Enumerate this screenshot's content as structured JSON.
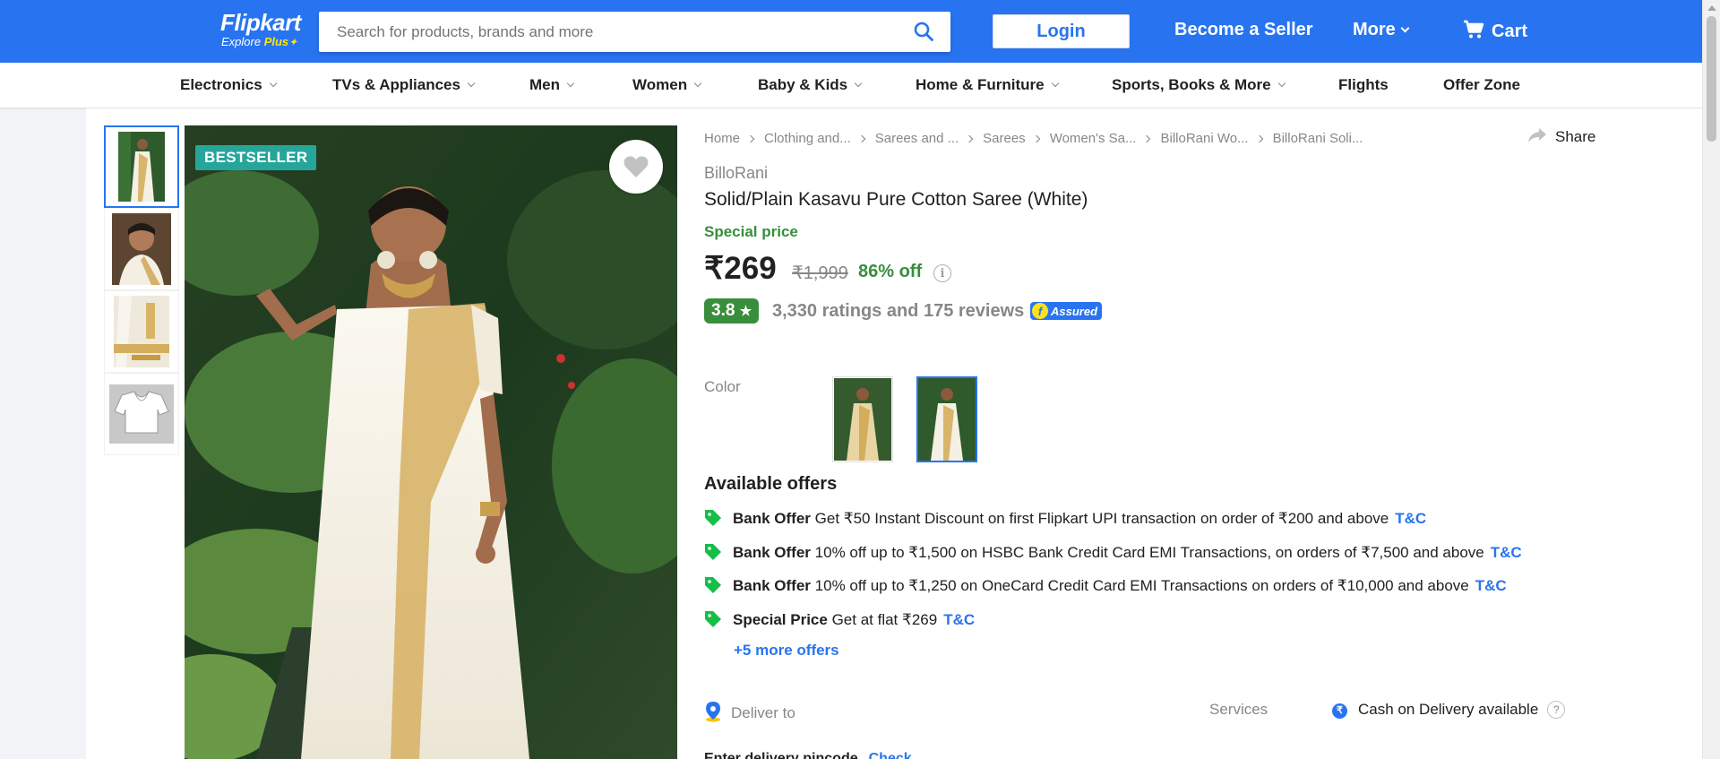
{
  "header": {
    "logo": {
      "brand": "Flipkart",
      "sub_prefix": "Explore",
      "sub_plus": "Plus"
    },
    "search": {
      "placeholder": "Search for products, brands and more",
      "value": ""
    },
    "login_label": "Login",
    "become_seller_label": "Become a Seller",
    "more_label": "More",
    "cart_label": "Cart",
    "colors": {
      "primary": "#2874f0",
      "accent": "#ffe500"
    }
  },
  "category_nav": [
    {
      "label": "Electronics",
      "has_dropdown": true
    },
    {
      "label": "TVs & Appliances",
      "has_dropdown": true
    },
    {
      "label": "Men",
      "has_dropdown": true
    },
    {
      "label": "Women",
      "has_dropdown": true
    },
    {
      "label": "Baby & Kids",
      "has_dropdown": true
    },
    {
      "label": "Home & Furniture",
      "has_dropdown": true
    },
    {
      "label": "Sports, Books & More",
      "has_dropdown": true
    },
    {
      "label": "Flights",
      "has_dropdown": false
    },
    {
      "label": "Offer Zone",
      "has_dropdown": false
    }
  ],
  "gallery": {
    "badge": "BESTSELLER",
    "thumbnails": [
      "saree-full",
      "saree-portrait",
      "saree-fabric",
      "blouse"
    ],
    "active_thumbnail": 0
  },
  "breadcrumbs": [
    "Home",
    "Clothing and...",
    "Sarees and ...",
    "Sarees",
    "Women's Sa...",
    "BilloRani Wo...",
    "BilloRani Soli..."
  ],
  "share_label": "Share",
  "product": {
    "seller": "BilloRani",
    "title": "Solid/Plain Kasavu Pure Cotton Saree  (White)",
    "special_label": "Special price",
    "price": "₹269",
    "mrp": "₹1,999",
    "discount": "86% off",
    "rating": "3.8",
    "rating_star": "★",
    "ratings_text": "3,330 ratings and 175 reviews",
    "assured_label": "Assured",
    "assured_f": "f"
  },
  "color": {
    "label": "Color",
    "options": [
      "Cream",
      "White"
    ],
    "selected": 1
  },
  "offers": {
    "heading": "Available offers",
    "items": [
      {
        "type": "Bank Offer",
        "text": "Get ₹50 Instant Discount on first Flipkart UPI transaction on order of ₹200 and above",
        "tc": "T&C"
      },
      {
        "type": "Bank Offer",
        "text": "10% off up to ₹1,500 on HSBC Bank Credit Card EMI Transactions, on orders of ₹7,500 and above",
        "tc": "T&C"
      },
      {
        "type": "Bank Offer",
        "text": "10% off up to ₹1,250 on OneCard Credit Card EMI Transactions on orders of ₹10,000 and above",
        "tc": "T&C"
      },
      {
        "type": "Special Price",
        "text": "Get at flat ₹269",
        "tc": "T&C"
      }
    ],
    "more_label": "+5 more offers",
    "tag_color": "#14be47"
  },
  "delivery": {
    "label": "Deliver to",
    "pincode_placeholder": "Enter delivery pincode",
    "check_label": "Check",
    "services_label": "Services",
    "cod_label": "Cash on Delivery available",
    "cod_icon": "₹",
    "help_icon": "?"
  }
}
